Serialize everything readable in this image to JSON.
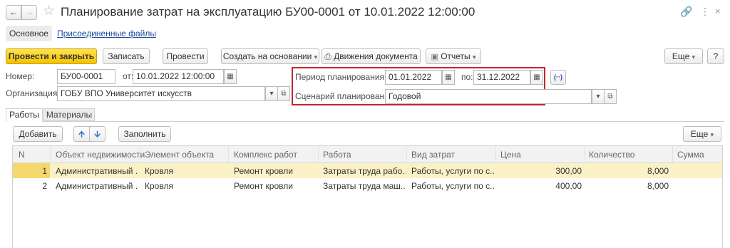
{
  "window": {
    "title": "Планирование затрат на эксплуатацию БУ00-0001 от 10.01.2022 12:00:00"
  },
  "form_tabs": [
    "Основное",
    "Присоединенные файлы"
  ],
  "toolbar": {
    "post_close": "Провести и закрыть",
    "save": "Записать",
    "post": "Провести",
    "create_based": "Создать на основании",
    "movements": "Движения документа",
    "reports": "Отчеты",
    "more": "Еще",
    "help": "?"
  },
  "fields": {
    "number_label": "Номер:",
    "number_value": "БУ00-0001",
    "date_label": "от:",
    "date_value": "10.01.2022 12:00:00",
    "org_label": "Организация:",
    "org_value": "ГОБУ ВПО Университет искусств",
    "period_label": "Период планирования с:",
    "period_from": "01.01.2022",
    "period_to_label": "по:",
    "period_to": "31.12.2022",
    "period_btn": "(··)",
    "scenario_label": "Сценарий планирования:",
    "scenario_value": "Годовой"
  },
  "subtabs": [
    "Работы",
    "Материалы"
  ],
  "table_toolbar": {
    "add": "Добавить",
    "fill": "Заполнить",
    "more": "Еще"
  },
  "table": {
    "columns": [
      "N",
      "Объект недвижимости",
      "Элемент объекта",
      "Комплекс работ",
      "Работа",
      "Вид затрат",
      "Цена",
      "Количество",
      "Сумма"
    ],
    "rows": [
      [
        "1",
        "Административный ...",
        "Кровля",
        "Ремонт кровли",
        "Затраты труда рабо...",
        "Работы, услуги по с...",
        "300,00",
        "8,000",
        ""
      ],
      [
        "2",
        "Административный ...",
        "Кровля",
        "Ремонт кровли",
        "Затраты труда маш...",
        "Работы, услуги по с...",
        "400,00",
        "8,000",
        ""
      ]
    ]
  },
  "colors": {
    "accent_yellow": "#f5c200",
    "selected_row": "#fbf1c6",
    "highlight_frame": "#c0272d"
  }
}
